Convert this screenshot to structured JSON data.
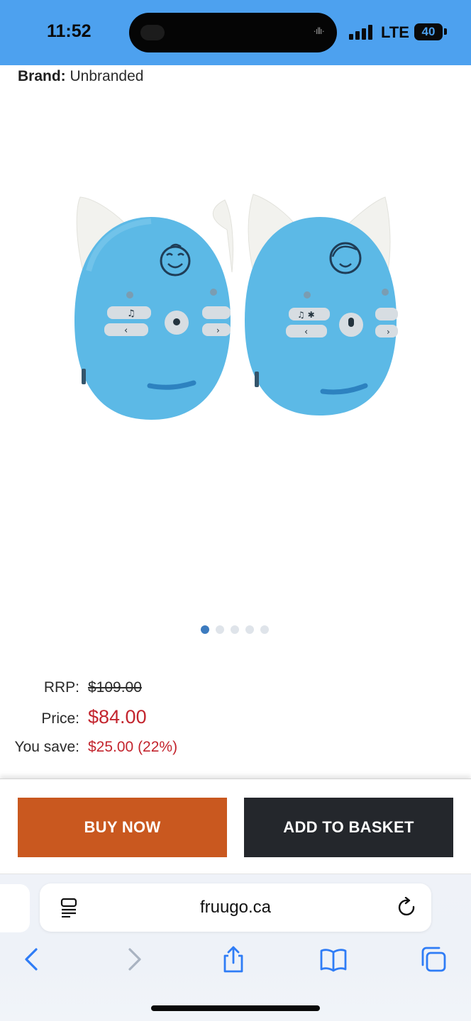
{
  "status_bar": {
    "time": "11:52",
    "network": "LTE",
    "battery": "40"
  },
  "brand": {
    "label": "Brand:",
    "value": "Unbranded"
  },
  "carousel": {
    "total": 5,
    "active": 1
  },
  "pricing": {
    "rrp_label": "RRP:",
    "rrp_value": "$109.00",
    "price_label": "Price:",
    "price_value": "$84.00",
    "save_label": "You save:",
    "save_value": "$25.00 (22%)"
  },
  "actions": {
    "buy_now": "BUY NOW",
    "add_to_basket": "ADD TO BASKET"
  },
  "browser": {
    "url": "fruugo.ca"
  },
  "colors": {
    "status_bar": "#4da1ef",
    "buy_button": "#c9581f",
    "basket_button": "#24272c",
    "price_red": "#c3252e",
    "product_blue": "#5cb9e6"
  }
}
